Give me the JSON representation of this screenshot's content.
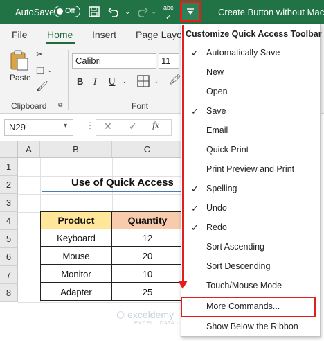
{
  "titlebar": {
    "autosave_label": "AutoSave",
    "toggle_text": "Off",
    "title": "Create Button without Macro"
  },
  "tabs": [
    "File",
    "Home",
    "Insert",
    "Page Layout"
  ],
  "ribbon": {
    "paste_label": "Paste",
    "clipboard_label": "Clipboard",
    "font_label": "Font",
    "font_name": "Calibri",
    "font_size": "11",
    "bold": "B",
    "italic": "I"
  },
  "formula_bar": {
    "name_box": "N29",
    "fx": "fx"
  },
  "columns": [
    "A",
    "B",
    "C"
  ],
  "rows": [
    "1",
    "2",
    "3",
    "4",
    "5",
    "6",
    "7",
    "8"
  ],
  "sheet": {
    "title": "Use of Quick Access",
    "headers": [
      "Product",
      "Quantity"
    ],
    "rows": [
      [
        "Keyboard",
        "12"
      ],
      [
        "Mouse",
        "20"
      ],
      [
        "Monitor",
        "10"
      ],
      [
        "Adapter",
        "25"
      ]
    ]
  },
  "menu": {
    "title": "Customize Quick Access Toolbar",
    "items": [
      {
        "label": "Automatically Save",
        "checked": "✓"
      },
      {
        "label": "New",
        "checked": ""
      },
      {
        "label": "Open",
        "checked": ""
      },
      {
        "label": "Save",
        "checked": "✓"
      },
      {
        "label": "Email",
        "checked": ""
      },
      {
        "label": "Quick Print",
        "checked": ""
      },
      {
        "label": "Print Preview and Print",
        "checked": ""
      },
      {
        "label": "Spelling",
        "checked": "✓"
      },
      {
        "label": "Undo",
        "checked": "✓"
      },
      {
        "label": "Redo",
        "checked": "✓"
      },
      {
        "label": "Sort Ascending",
        "checked": ""
      },
      {
        "label": "Sort Descending",
        "checked": ""
      },
      {
        "label": "Touch/Mouse Mode",
        "checked": ""
      },
      {
        "label": "More Commands...",
        "checked": ""
      },
      {
        "label": "Show Below the Ribbon",
        "checked": ""
      }
    ]
  },
  "watermark": {
    "name": "exceldemy",
    "tagline": "EXCEL · DATA · BI"
  },
  "colors": {
    "excel_green": "#217346",
    "highlight_red": "#e0201c",
    "header_yellow": "#ffe699",
    "header_orange": "#f8cbad"
  }
}
